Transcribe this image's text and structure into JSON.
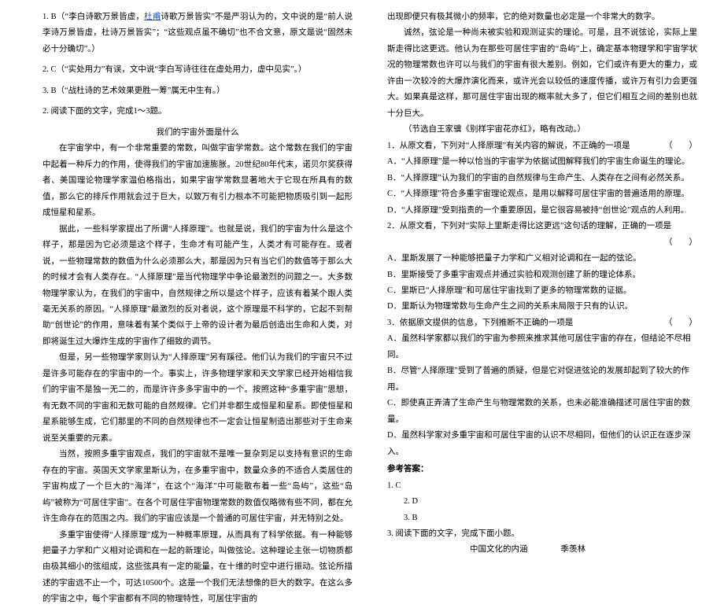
{
  "left": {
    "p1a": "1. B（“李白诗歌万景皆虚，",
    "p1link": "杜甫",
    "p1b": "诗歌万景皆实”不是严羽认为的，文中说的是“前人说李诗万景皆虚，杜诗万景皆实”；“这些观点虽不确切”也不合文意，原文是说“固然未必十分确切”。）",
    "p2": "2. C（“实处用力”有误，文中说“李白写诗往往在虚处用力，虚中见实”。）",
    "p3": "3. B（“战杜诗的艺术效果更胜一筹”属无中生有。）",
    "p4": "2. 阅读下面的文字，完成1～3题。",
    "p5": "我们的宇宙外面是什么",
    "p6": "在宇宙学中，有一个非常重要的常数，叫做宇宙学常数。这个常数在我们的宇宙中起着一种斥力的作用，使得我们的宇宙加速膨胀。20世纪80年代末，诺贝尔奖获得者、美国理论物理学家温伯格指出，如果宇宙学常数显著地大于它现在所具有的数值，那么它的排斥作用就会过于巨大，以致万有引力根本不可能把物质吸引到一起形成恒星和星系。",
    "p7": "据此，一些科学家提出了所谓“人择原理”。也就是说，我们的宇宙为什么是这个样子，那是因为它必须是这个样子，生命才有可能产生，人类才有可能存在。或者说，一些物理常数的数值为什么必须那么大，那是因为只有当它们的数值等于那么大的时候才会有人类存在。“人择原理”是当代物理学中争论最激烈的问题之一。大多数物理学家认为，在我们的宇宙中，自然规律之所以是这个样子，应该有着某个跟人类毫无关系的原因。“人择原理”最激烈的反对者说，这个原理是不科学的，它起不到帮助“创世论”的作用，意味着有某个类似于上帝的设计者为最后创造出生命和人类，对即将诞生过大爆炸生成的宇宙作了细致的调节。",
    "p8": "但是，另一些物理学家则认为“人择原理”另有蹊径。他们认为我们的宇宙只不过是许多可能存在的宇宙中的一个。事实上，许多物理学家和天文学家已经开始相信我们的宇宙不是独一无二的，而是许许多多宇宙中的一个。按照这种“多重宇宙”思想，有无数不同的宇宙和无数可能的自然规律。它们并非都生成恒星和星系。即使恒星和星系能够生成，它们那里的不同的自然规律也不一定会让恒星制造出那些对于生命来说至关重要的元素。",
    "p9": "当然，按照多重宇宙观点，我们的宇宙就不是唯一复杂到足以支持有意识的生命存在的宇宙。英国天文学家里斯认为，在多重宇宙中，数量众多的不适合人类居住的宇宙构成了一个巨大的“海洋”，在这个“海洋”中可能散布着一些“岛屿”，这些“岛屿”被称为“可居住宇宙”。在各个可居住宇宙物理常数的数值仅略微有些不同，都在允许生命存在的范围之内。我们的宇宙应该是一个普通的可居住宇宙，并无特别之处。",
    "p10": "多重宇宙使得“人择原理”成为一种概率原理，从而具有了科学依据。有一种能够把量子力学和广义相对论调和在一起的新理论，叫做弦论。这种理论主张一切物质都由极其细小的弦组成，这些弦具有一定的能量，在十维的时空中进行振动。弦论所描述的宇宙远不止一个，可达10500个。这是一个我们无法想像的巨大的数字。在这么多的宇宙之中，每个宇宙都有不同的物理特性，可居住宇宙的"
  },
  "right": {
    "p1": "出现即便只有极其微小的频率，它的绝对数量也必定是一个非常大的数字。",
    "p2": "诚然，弦论是一种尚未被实验和观测证实的理论。可是，且不说弦论，实际上里斯走得比这更远。他认为在那些可居住宇宙的“岛屿”上，确定基本物理学和宇宙学状况的物理常数也许可以与我们的宇宙有很大差别。例如，它们或许有更大的重力，或许由一次较冷的大爆炸演化而来，或许光会以较低的速度传播，或许万有引力会更强大。如果真是这样，那可居住宇宙出现的概率就大多了，但它们相互之间的差别也就十分巨大。",
    "p3": "（节选自王家骥《别样宇宙花亦红》，略有改动。）",
    "q1stem": "1．从原文看，下列对“人择原理”有关内容的解说，不正确的一项是",
    "q1paren": "（　　）",
    "q1a": "A．“人择原理”是一种以恰当的宇宙学为依据试图解释我们的宇宙生命诞生的理论。",
    "q1b": "B．“人择原理”认为我们的宇宙的自然规律与生命产生、人类存在之间有必然关系。",
    "q1c": "C．“人择原理”符合多重宇宙理论观点，是用以解释可居住宇宙的普遍适用的原理。",
    "q1d": "D．“人择原理”受到指责的一个重要原因，是它很容易被持“创世论”观点的人利用。",
    "q2stem": "2．从原文看，下列对“实际上里斯走得比这更远”这句话的理解，正确的一项是",
    "q2paren": "（　　）",
    "q2a": "A．里斯发展了一种能够把量子力学和广义相对论调和在一起的弦论。",
    "q2b": "B．里斯接受了多重宇宙观点并通过实验和观测创建了新的理论体系。",
    "q2c": "C．里斯已“人择原理”和可居住宇宙找到了更多的物理常数的证据。",
    "q2d": "D．里斯认为物理常数与生命产生之间的关系未局限于只有的认识。",
    "q3stem": "3．依据原文提供的信息，下列推断不正确的一项是",
    "q3paren": "（　　）",
    "q3a": "A．虽然科学家都以我们的宇宙为参照来推求其他可居住宇宙的存在，但结论不尽相同。",
    "q3b": "B．尽管“人择原理”受到了普遍的质疑，但是它对促进弦论的发展却起到了较大的作用。",
    "q3c": "C．即使真正弄清了生命产生与物理常数的关系，也未必能准确描述可居住宇宙的数量。",
    "q3d": "D．虽然科学家对多重宇宙和可居住宇宙的认识不尽相同，但他们的认识正在逐步深入。",
    "ansLabel": "参考答案：",
    "ans1": "1. C",
    "ans2": "2. D",
    "ans3": "3. B",
    "next1": "3. 阅读下面的文字，完成下面小题。",
    "next2a": "中国文化的内涵",
    "next2b": "季羡林"
  }
}
